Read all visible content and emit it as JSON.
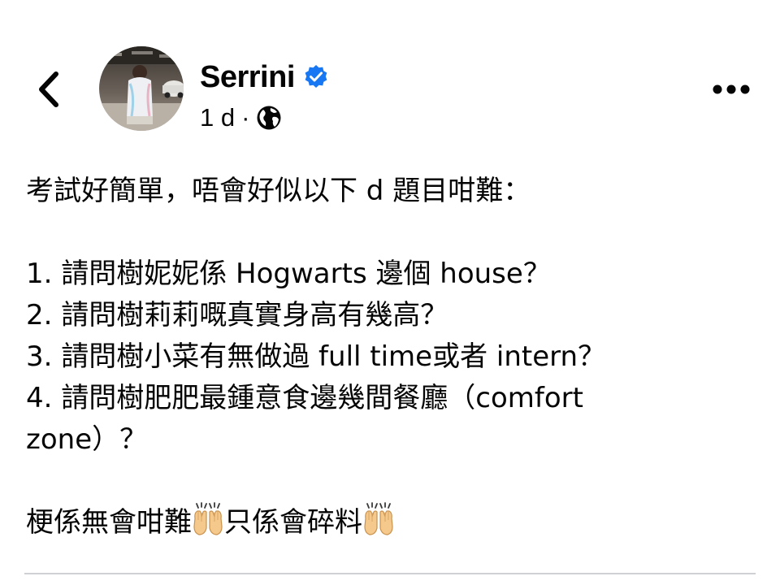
{
  "header": {
    "back_icon": "chevron-left-icon",
    "author_name": "Serrini",
    "verified_icon": "verified-badge-icon",
    "verified_color": "#1877f2",
    "timestamp": "1 d",
    "separator": "·",
    "audience_icon": "globe-icon",
    "more_icon": "more-horizontal-icon"
  },
  "post": {
    "line1": "考試好簡單，唔會好似以下 d 題目咁難：",
    "q1": "1. 請問樹妮妮係 Hogwarts 邊個 house？",
    "q2": "2. 請問樹莉莉嘅真實身高有幾高？",
    "q3": "3. 請問樹小菜有無做過 full time或者 intern？",
    "q4a": "4. 請問樹肥肥最鍾意食邊幾間餐廳（comfort",
    "q4b": "zone）？",
    "last_a": "梗係無會咁難",
    "last_b": "只係會碎料",
    "emoji_icon": "raising-hands-emoji-icon"
  }
}
